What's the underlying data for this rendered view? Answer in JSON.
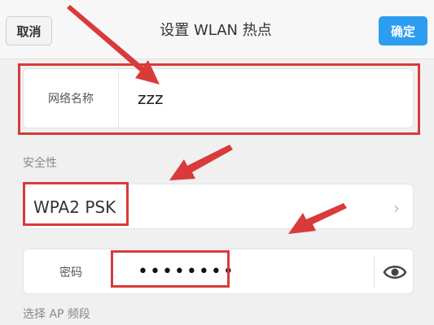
{
  "header": {
    "cancel_label": "取消",
    "title": "设置 WLAN 热点",
    "confirm_label": "确定"
  },
  "network": {
    "name_label": "网络名称",
    "name_value": "zzz"
  },
  "security": {
    "section_label": "安全性",
    "value": "WPA2 PSK"
  },
  "password": {
    "label": "密码",
    "masked_value": "••••••••"
  },
  "band": {
    "section_label": "选择 AP 频段"
  },
  "colors": {
    "accent": "#2d9df0",
    "annotation_red": "#d93a3a"
  },
  "icons": {
    "chevron": "chevron-right-icon",
    "eye": "eye-icon"
  }
}
